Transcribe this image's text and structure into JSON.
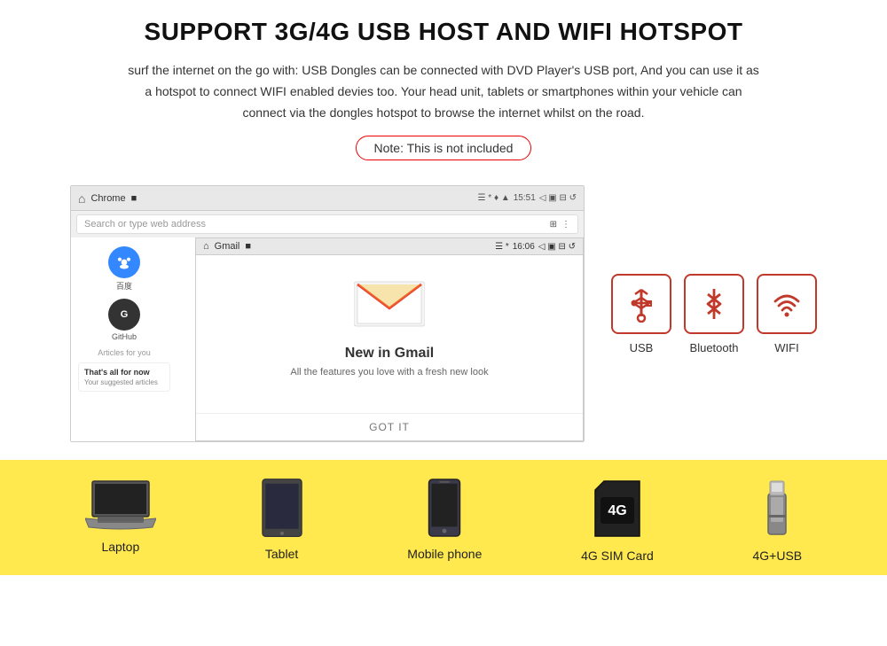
{
  "page": {
    "title": "SUPPORT 3G/4G USB HOST AND WIFI HOTSPOT",
    "description": "surf the internet on the go with: USB Dongles can be connected with DVD Player's USB port, And you can use it as a hotspot to connect WIFI enabled devies too. Your head unit, tablets or smartphones within your vehicle can connect via the dongles hotspot to browse the internet whilst on the road.",
    "note": "Note: This is not included"
  },
  "browser": {
    "app_name": "Chrome",
    "stop_btn": "■",
    "status_bar": "✦ * ♥ ▲ 15:51 ◁ ▩ ⊟ ↺",
    "search_placeholder": "Search or type web address",
    "home_icon": "⌂"
  },
  "gmail_panel": {
    "app_name": "Gmail",
    "stop_btn": "■",
    "status_bar": "✦ * ▲ 16:06 ◁ ▩ ⊟ ↺",
    "new_title": "New in Gmail",
    "subtitle": "All the features you love with a fresh new look",
    "got_it": "GOT IT"
  },
  "chrome_content": {
    "baidu_label": "百度",
    "github_label": "GitHub",
    "articles_label": "Articles for you",
    "thats_all_title": "That's all for now",
    "thats_all_sub": "Your suggested articles"
  },
  "connectivity": {
    "usb_label": "USB",
    "bluetooth_label": "Bluetooth",
    "wifi_label": "WIFI"
  },
  "devices": {
    "laptop_label": "Laptop",
    "tablet_label": "Tablet",
    "phone_label": "Mobile phone",
    "sim_label": "4G SIM Card",
    "usb_label": "4G+USB"
  }
}
